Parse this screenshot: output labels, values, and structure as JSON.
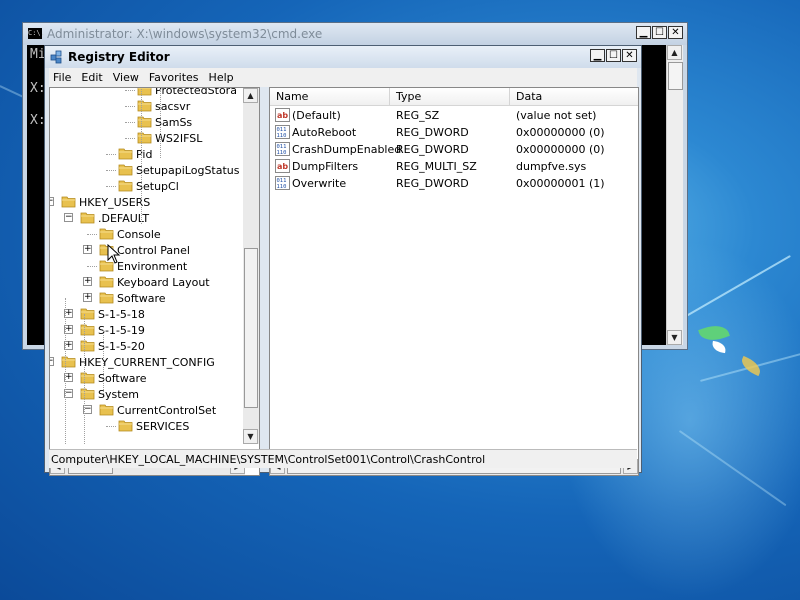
{
  "cmd": {
    "title": "Administrator: X:\\windows\\system32\\cmd.exe",
    "icon_text": "C:\\.",
    "lines": [
      "Mi",
      "X:",
      "X:"
    ]
  },
  "regedit": {
    "title": "Registry Editor",
    "menu": [
      "File",
      "Edit",
      "View",
      "Favorites",
      "Help"
    ],
    "tree": [
      {
        "label": "ProtectedStora",
        "level": 5,
        "expander": ""
      },
      {
        "label": "sacsvr",
        "level": 5,
        "expander": ""
      },
      {
        "label": "SamSs",
        "level": 5,
        "expander": ""
      },
      {
        "label": "WS2IFSL",
        "level": 5,
        "expander": ""
      },
      {
        "label": "Pid",
        "level": 4,
        "expander": ""
      },
      {
        "label": "SetupapiLogStatus",
        "level": 4,
        "expander": ""
      },
      {
        "label": "SetupCl",
        "level": 4,
        "expander": ""
      },
      {
        "label": "HKEY_USERS",
        "level": 1,
        "expander": "−"
      },
      {
        "label": ".DEFAULT",
        "level": 2,
        "expander": "−"
      },
      {
        "label": "Console",
        "level": 3,
        "expander": ""
      },
      {
        "label": "Control Panel",
        "level": 3,
        "expander": "+"
      },
      {
        "label": "Environment",
        "level": 3,
        "expander": ""
      },
      {
        "label": "Keyboard Layout",
        "level": 3,
        "expander": "+"
      },
      {
        "label": "Software",
        "level": 3,
        "expander": "+"
      },
      {
        "label": "S-1-5-18",
        "level": 2,
        "expander": "+"
      },
      {
        "label": "S-1-5-19",
        "level": 2,
        "expander": "+"
      },
      {
        "label": "S-1-5-20",
        "level": 2,
        "expander": "+"
      },
      {
        "label": "HKEY_CURRENT_CONFIG",
        "level": 1,
        "expander": "−"
      },
      {
        "label": "Software",
        "level": 2,
        "expander": "+"
      },
      {
        "label": "System",
        "level": 2,
        "expander": "−"
      },
      {
        "label": "CurrentControlSet",
        "level": 3,
        "expander": "−"
      },
      {
        "label": "SERVICES",
        "level": 4,
        "expander": ""
      }
    ],
    "columns": [
      "Name",
      "Type",
      "Data"
    ],
    "values": [
      {
        "icon": "string",
        "name": "(Default)",
        "type": "REG_SZ",
        "data": "(value not set)"
      },
      {
        "icon": "binary",
        "name": "AutoReboot",
        "type": "REG_DWORD",
        "data": "0x00000000 (0)"
      },
      {
        "icon": "binary",
        "name": "CrashDumpEnabled",
        "type": "REG_DWORD",
        "data": "0x00000000 (0)"
      },
      {
        "icon": "string",
        "name": "DumpFilters",
        "type": "REG_MULTI_SZ",
        "data": "dumpfve.sys"
      },
      {
        "icon": "binary",
        "name": "Overwrite",
        "type": "REG_DWORD",
        "data": "0x00000001 (1)"
      }
    ],
    "status_path": "Computer\\HKEY_LOCAL_MACHINE\\SYSTEM\\ControlSet001\\Control\\CrashControl"
  },
  "colors": {
    "folder": "#e8c14f",
    "desktop": "#1565b8"
  }
}
